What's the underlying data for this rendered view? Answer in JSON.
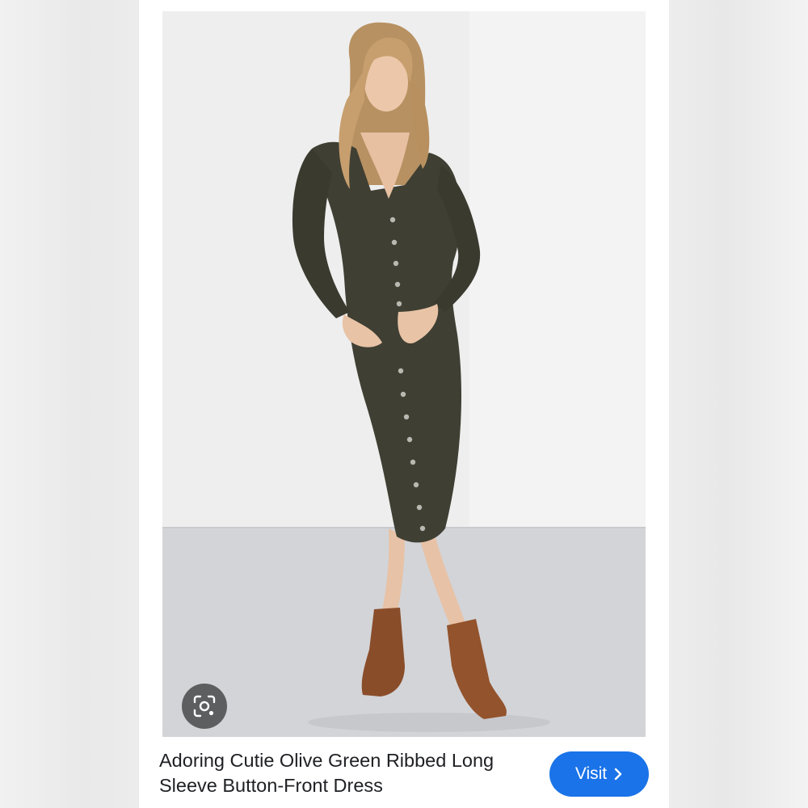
{
  "product": {
    "title": "Adoring Cutie Olive Green Ribbed Long Sleeve Button-Front Dress",
    "image_alt": "Woman wearing olive green ribbed long sleeve button-front midi dress with brown suede ankle boots"
  },
  "actions": {
    "visit_label": "Visit",
    "visit_icon": "chevron-right-icon",
    "lens_icon": "visual-search-icon"
  },
  "colors": {
    "accent": "#1a73e8",
    "dress": "#3f3f33",
    "boots": "#8a4d2a",
    "wall": "#efefef",
    "floor": "#d4d5d9"
  }
}
